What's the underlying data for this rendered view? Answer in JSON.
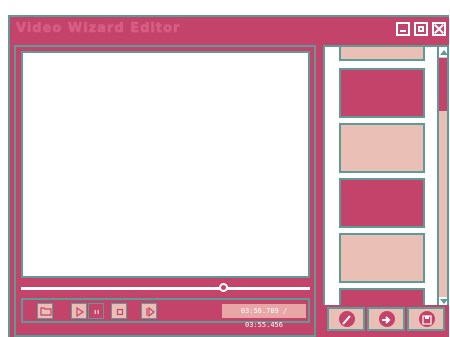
{
  "window": {
    "title": "Video Wizard Editor",
    "controls": [
      "minimize-icon",
      "maximize-icon",
      "close-icon"
    ]
  },
  "player": {
    "time_readout": "03:56.789 / 03:55.456",
    "seek_position": 0.7,
    "buttons": [
      "folder-icon",
      "play-icon",
      "pause-icon",
      "stop-icon",
      "next-frame-icon"
    ],
    "active_button": "pause-icon"
  },
  "timeline": {
    "thumbnails": [
      "light",
      "dark",
      "light",
      "dark",
      "light",
      "dark"
    ]
  },
  "actions": [
    "pencil-icon",
    "arrow-right-icon",
    "save-icon"
  ],
  "colors": {
    "primary": "#c4436a",
    "accent_light": "#eabfb6",
    "border": "#5e9b96",
    "time_bg": "#e8a6a6"
  }
}
